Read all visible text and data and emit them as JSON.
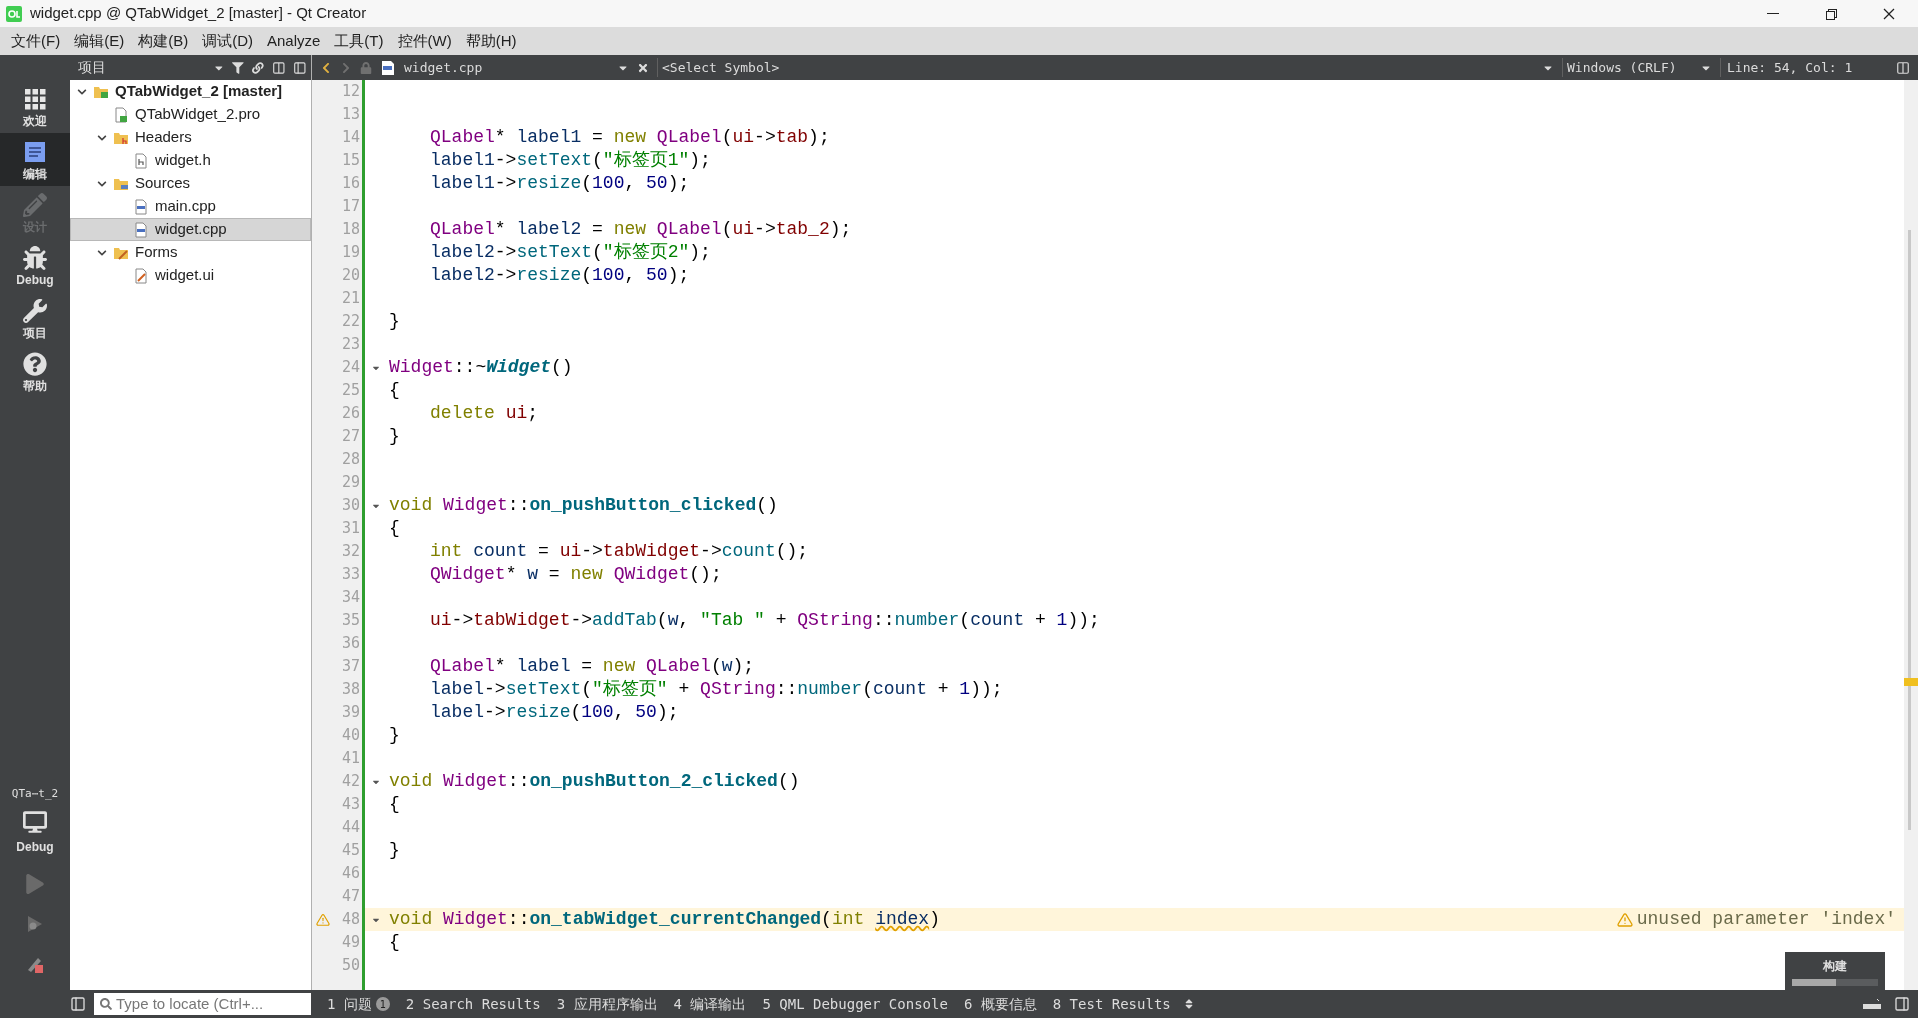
{
  "window": {
    "title": "widget.cpp @ QTabWidget_2 [master] - Qt Creator"
  },
  "menu": [
    "文件(F)",
    "编辑(E)",
    "构建(B)",
    "调试(D)",
    "Analyze",
    "工具(T)",
    "控件(W)",
    "帮助(H)"
  ],
  "modes": [
    {
      "label": "欢迎",
      "kind": "welcome",
      "selected": false,
      "disabled": false
    },
    {
      "label": "编辑",
      "kind": "edit",
      "selected": true,
      "disabled": false
    },
    {
      "label": "设计",
      "kind": "design",
      "selected": false,
      "disabled": true
    },
    {
      "label": "Debug",
      "kind": "debug",
      "selected": false,
      "disabled": false
    },
    {
      "label": "项目",
      "kind": "projects",
      "selected": false,
      "disabled": false
    },
    {
      "label": "帮助",
      "kind": "help",
      "selected": false,
      "disabled": false
    }
  ],
  "kit": {
    "name": "QTa⋯t_2",
    "build": "Debug"
  },
  "run_buttons": [
    {
      "kind": "run"
    },
    {
      "kind": "debug_run"
    },
    {
      "kind": "build"
    }
  ],
  "project_panel": {
    "title": "项目",
    "tree": [
      {
        "label": "QTabWidget_2 [master]",
        "kind": "project",
        "expanded": true,
        "selected": false,
        "children": [
          {
            "label": "QTabWidget_2.pro",
            "kind": "pro",
            "selected": false
          },
          {
            "label": "Headers",
            "kind": "folder_h",
            "expanded": true,
            "selected": false,
            "children": [
              {
                "label": "widget.h",
                "kind": "header",
                "selected": false
              }
            ]
          },
          {
            "label": "Sources",
            "kind": "folder_cpp",
            "expanded": true,
            "selected": false,
            "children": [
              {
                "label": "main.cpp",
                "kind": "source",
                "selected": false
              },
              {
                "label": "widget.cpp",
                "kind": "source",
                "selected": true
              }
            ]
          },
          {
            "label": "Forms",
            "kind": "folder_ui",
            "expanded": true,
            "selected": false,
            "children": [
              {
                "label": "widget.ui",
                "kind": "form",
                "selected": false
              }
            ]
          }
        ]
      }
    ]
  },
  "editor_toolbar": {
    "file": "widget.cpp",
    "symbol": "<Select Symbol>",
    "line_ending": "Windows (CRLF)",
    "position": "Line: 54, Col: 1"
  },
  "code": [
    {
      "number": "12"
    },
    {
      "number": "13"
    },
    {
      "number": "14",
      "indent": true,
      "tokens": [
        {
          "text": "QLabel",
          "kind": "type"
        },
        {
          "text": "* ",
          "kind": "punct"
        },
        {
          "text": "label1",
          "kind": "var"
        },
        {
          "text": " = ",
          "kind": "punct"
        },
        {
          "text": "new ",
          "kind": "keyword"
        },
        {
          "text": "QLabel",
          "kind": "type"
        },
        {
          "text": "(",
          "kind": "punct"
        },
        {
          "text": "ui",
          "kind": "field"
        },
        {
          "text": "->",
          "kind": "punct"
        },
        {
          "text": "tab",
          "kind": "field"
        },
        {
          "text": ");",
          "kind": "punct"
        }
      ]
    },
    {
      "number": "15",
      "indent": true,
      "tokens": [
        {
          "text": "label1",
          "kind": "var"
        },
        {
          "text": "->",
          "kind": "punct"
        },
        {
          "text": "setText",
          "kind": "func"
        },
        {
          "text": "(",
          "kind": "punct"
        },
        {
          "text": "\"标签页1\"",
          "kind": "string"
        },
        {
          "text": ");",
          "kind": "punct"
        }
      ]
    },
    {
      "number": "16",
      "indent": true,
      "tokens": [
        {
          "text": "label1",
          "kind": "var"
        },
        {
          "text": "->",
          "kind": "punct"
        },
        {
          "text": "resize",
          "kind": "func"
        },
        {
          "text": "(",
          "kind": "punct"
        },
        {
          "text": "100",
          "kind": "number"
        },
        {
          "text": ", ",
          "kind": "punct"
        },
        {
          "text": "50",
          "kind": "number"
        },
        {
          "text": ");",
          "kind": "punct"
        }
      ]
    },
    {
      "number": "17"
    },
    {
      "number": "18",
      "indent": true,
      "tokens": [
        {
          "text": "QLabel",
          "kind": "type"
        },
        {
          "text": "* ",
          "kind": "punct"
        },
        {
          "text": "label2",
          "kind": "var"
        },
        {
          "text": " = ",
          "kind": "punct"
        },
        {
          "text": "new ",
          "kind": "keyword"
        },
        {
          "text": "QLabel",
          "kind": "type"
        },
        {
          "text": "(",
          "kind": "punct"
        },
        {
          "text": "ui",
          "kind": "field"
        },
        {
          "text": "->",
          "kind": "punct"
        },
        {
          "text": "tab_2",
          "kind": "field"
        },
        {
          "text": ");",
          "kind": "punct"
        }
      ]
    },
    {
      "number": "19",
      "indent": true,
      "tokens": [
        {
          "text": "label2",
          "kind": "var"
        },
        {
          "text": "->",
          "kind": "punct"
        },
        {
          "text": "setText",
          "kind": "func"
        },
        {
          "text": "(",
          "kind": "punct"
        },
        {
          "text": "\"标签页2\"",
          "kind": "string"
        },
        {
          "text": ");",
          "kind": "punct"
        }
      ]
    },
    {
      "number": "20",
      "indent": true,
      "tokens": [
        {
          "text": "label2",
          "kind": "var"
        },
        {
          "text": "->",
          "kind": "punct"
        },
        {
          "text": "resize",
          "kind": "func"
        },
        {
          "text": "(",
          "kind": "punct"
        },
        {
          "text": "100",
          "kind": "number"
        },
        {
          "text": ", ",
          "kind": "punct"
        },
        {
          "text": "50",
          "kind": "number"
        },
        {
          "text": ");",
          "kind": "punct"
        }
      ]
    },
    {
      "number": "21"
    },
    {
      "number": "22",
      "tokens": [
        {
          "text": "}",
          "kind": "punct"
        }
      ]
    },
    {
      "number": "23"
    },
    {
      "number": "24",
      "fold": true,
      "tokens": [
        {
          "text": "Widget",
          "kind": "type"
        },
        {
          "text": "::~",
          "kind": "punct"
        },
        {
          "text": "Widget",
          "kind": "dtor"
        },
        {
          "text": "()",
          "kind": "punct"
        }
      ]
    },
    {
      "number": "25",
      "tokens": [
        {
          "text": "{",
          "kind": "punct"
        }
      ]
    },
    {
      "number": "26",
      "indent": true,
      "tokens": [
        {
          "text": "delete ",
          "kind": "keyword"
        },
        {
          "text": "ui",
          "kind": "field"
        },
        {
          "text": ";",
          "kind": "punct"
        }
      ]
    },
    {
      "number": "27",
      "tokens": [
        {
          "text": "}",
          "kind": "punct"
        }
      ]
    },
    {
      "number": "28"
    },
    {
      "number": "29"
    },
    {
      "number": "30",
      "fold": true,
      "tokens": [
        {
          "text": "void ",
          "kind": "keyword"
        },
        {
          "text": "Widget",
          "kind": "type"
        },
        {
          "text": "::",
          "kind": "punct"
        },
        {
          "text": "on_pushButton_clicked",
          "kind": "funcdef"
        },
        {
          "text": "()",
          "kind": "punct"
        }
      ]
    },
    {
      "number": "31",
      "tokens": [
        {
          "text": "{",
          "kind": "punct"
        }
      ]
    },
    {
      "number": "32",
      "indent": true,
      "tokens": [
        {
          "text": "int ",
          "kind": "keyword"
        },
        {
          "text": "count",
          "kind": "var"
        },
        {
          "text": " = ",
          "kind": "punct"
        },
        {
          "text": "ui",
          "kind": "field"
        },
        {
          "text": "->",
          "kind": "punct"
        },
        {
          "text": "tabWidget",
          "kind": "field"
        },
        {
          "text": "->",
          "kind": "punct"
        },
        {
          "text": "count",
          "kind": "func"
        },
        {
          "text": "();",
          "kind": "punct"
        }
      ]
    },
    {
      "number": "33",
      "indent": true,
      "tokens": [
        {
          "text": "QWidget",
          "kind": "type"
        },
        {
          "text": "* ",
          "kind": "punct"
        },
        {
          "text": "w",
          "kind": "var"
        },
        {
          "text": " = ",
          "kind": "punct"
        },
        {
          "text": "new ",
          "kind": "keyword"
        },
        {
          "text": "QWidget",
          "kind": "type"
        },
        {
          "text": "();",
          "kind": "punct"
        }
      ]
    },
    {
      "number": "34"
    },
    {
      "number": "35",
      "indent": true,
      "tokens": [
        {
          "text": "ui",
          "kind": "field"
        },
        {
          "text": "->",
          "kind": "punct"
        },
        {
          "text": "tabWidget",
          "kind": "field"
        },
        {
          "text": "->",
          "kind": "punct"
        },
        {
          "text": "addTab",
          "kind": "func"
        },
        {
          "text": "(",
          "kind": "punct"
        },
        {
          "text": "w",
          "kind": "var"
        },
        {
          "text": ", ",
          "kind": "punct"
        },
        {
          "text": "\"Tab \"",
          "kind": "string"
        },
        {
          "text": " + ",
          "kind": "punct"
        },
        {
          "text": "QString",
          "kind": "type"
        },
        {
          "text": "::",
          "kind": "punct"
        },
        {
          "text": "number",
          "kind": "func"
        },
        {
          "text": "(",
          "kind": "punct"
        },
        {
          "text": "count",
          "kind": "var"
        },
        {
          "text": " + ",
          "kind": "punct"
        },
        {
          "text": "1",
          "kind": "number"
        },
        {
          "text": "));",
          "kind": "punct"
        }
      ]
    },
    {
      "number": "36"
    },
    {
      "number": "37",
      "indent": true,
      "tokens": [
        {
          "text": "QLabel",
          "kind": "type"
        },
        {
          "text": "* ",
          "kind": "punct"
        },
        {
          "text": "label",
          "kind": "var"
        },
        {
          "text": " = ",
          "kind": "punct"
        },
        {
          "text": "new ",
          "kind": "keyword"
        },
        {
          "text": "QLabel",
          "kind": "type"
        },
        {
          "text": "(",
          "kind": "punct"
        },
        {
          "text": "w",
          "kind": "var"
        },
        {
          "text": ");",
          "kind": "punct"
        }
      ]
    },
    {
      "number": "38",
      "indent": true,
      "tokens": [
        {
          "text": "label",
          "kind": "var"
        },
        {
          "text": "->",
          "kind": "punct"
        },
        {
          "text": "setText",
          "kind": "func"
        },
        {
          "text": "(",
          "kind": "punct"
        },
        {
          "text": "\"标签页\"",
          "kind": "string"
        },
        {
          "text": " + ",
          "kind": "punct"
        },
        {
          "text": "QString",
          "kind": "type"
        },
        {
          "text": "::",
          "kind": "punct"
        },
        {
          "text": "number",
          "kind": "func"
        },
        {
          "text": "(",
          "kind": "punct"
        },
        {
          "text": "count",
          "kind": "var"
        },
        {
          "text": " + ",
          "kind": "punct"
        },
        {
          "text": "1",
          "kind": "number"
        },
        {
          "text": "));",
          "kind": "punct"
        }
      ]
    },
    {
      "number": "39",
      "indent": true,
      "tokens": [
        {
          "text": "label",
          "kind": "var"
        },
        {
          "text": "->",
          "kind": "punct"
        },
        {
          "text": "resize",
          "kind": "func"
        },
        {
          "text": "(",
          "kind": "punct"
        },
        {
          "text": "100",
          "kind": "number"
        },
        {
          "text": ", ",
          "kind": "punct"
        },
        {
          "text": "50",
          "kind": "number"
        },
        {
          "text": ");",
          "kind": "punct"
        }
      ]
    },
    {
      "number": "40",
      "tokens": [
        {
          "text": "}",
          "kind": "punct"
        }
      ]
    },
    {
      "number": "41"
    },
    {
      "number": "42",
      "fold": true,
      "tokens": [
        {
          "text": "void ",
          "kind": "keyword"
        },
        {
          "text": "Widget",
          "kind": "type"
        },
        {
          "text": "::",
          "kind": "punct"
        },
        {
          "text": "on_pushButton_2_clicked",
          "kind": "funcdef"
        },
        {
          "text": "()",
          "kind": "punct"
        }
      ]
    },
    {
      "number": "43",
      "tokens": [
        {
          "text": "{",
          "kind": "punct"
        }
      ]
    },
    {
      "number": "44"
    },
    {
      "number": "45",
      "tokens": [
        {
          "text": "}",
          "kind": "punct"
        }
      ]
    },
    {
      "number": "46"
    },
    {
      "number": "47"
    },
    {
      "number": "48",
      "fold": true,
      "warning": true,
      "annotation": "unused parameter 'index'",
      "tokens": [
        {
          "text": "void ",
          "kind": "keyword"
        },
        {
          "text": "Widget",
          "kind": "type"
        },
        {
          "text": "::",
          "kind": "punct"
        },
        {
          "text": "on_tabWidget_currentChanged",
          "kind": "funcdef"
        },
        {
          "text": "(",
          "kind": "punct"
        },
        {
          "text": "int ",
          "kind": "keyword"
        },
        {
          "text": "index",
          "kind": "warn"
        },
        {
          "text": ")",
          "kind": "punct"
        }
      ]
    },
    {
      "number": "49",
      "tokens": [
        {
          "text": "{",
          "kind": "punct"
        }
      ]
    },
    {
      "number": "50"
    }
  ],
  "build_popup": {
    "title": "构建",
    "level": 0.51
  },
  "locator": {
    "placeholder": "Type to locate (Ctrl+..."
  },
  "output_tabs": [
    {
      "label": "1 问题",
      "badge": "1"
    },
    {
      "label": "2 Search Results"
    },
    {
      "label": "3 应用程序输出"
    },
    {
      "label": "4 编译输出"
    },
    {
      "label": "5 QML Debugger Console"
    },
    {
      "label": "6 概要信息"
    },
    {
      "label": "8 Test Results"
    }
  ]
}
